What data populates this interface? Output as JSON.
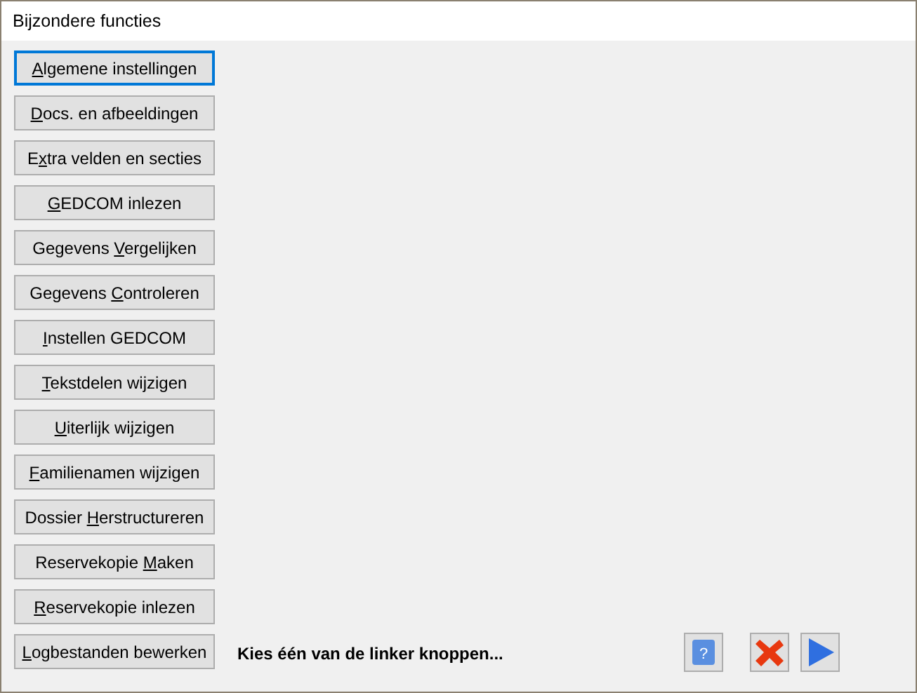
{
  "window": {
    "title": "Bijzondere functies"
  },
  "buttons": [
    {
      "key": "A",
      "post": "lgemene instellingen",
      "focused": true
    },
    {
      "key": "D",
      "post": "ocs. en afbeeldingen",
      "focused": false
    },
    {
      "pre": "E",
      "key": "x",
      "post": "tra velden en secties",
      "focused": false
    },
    {
      "key": "G",
      "post": "EDCOM inlezen",
      "focused": false
    },
    {
      "pre": "Gegevens ",
      "key": "V",
      "post": "ergelijken",
      "focused": false
    },
    {
      "pre": "Gegevens ",
      "key": "C",
      "post": "ontroleren",
      "focused": false
    },
    {
      "key": "I",
      "post": "nstellen GEDCOM",
      "focused": false
    },
    {
      "key": "T",
      "post": "ekstdelen wijzigen",
      "focused": false
    },
    {
      "key": "U",
      "post": "iterlijk wijzigen",
      "focused": false
    },
    {
      "key": "F",
      "post": "amilienamen wijzigen",
      "focused": false
    },
    {
      "pre": "Dossier ",
      "key": "H",
      "post": "erstructureren",
      "focused": false
    },
    {
      "pre": "Reservekopie ",
      "key": "M",
      "post": "aken",
      "focused": false
    },
    {
      "key": "R",
      "post": "eservekopie inlezen",
      "focused": false
    },
    {
      "key": "L",
      "post": "ogbestanden bewerken",
      "focused": false
    }
  ],
  "hint": "Kies één van de linker knoppen...",
  "actions": [
    {
      "kind": "help",
      "glyph": "?"
    },
    {
      "kind": "cancel"
    },
    {
      "kind": "ok"
    }
  ]
}
